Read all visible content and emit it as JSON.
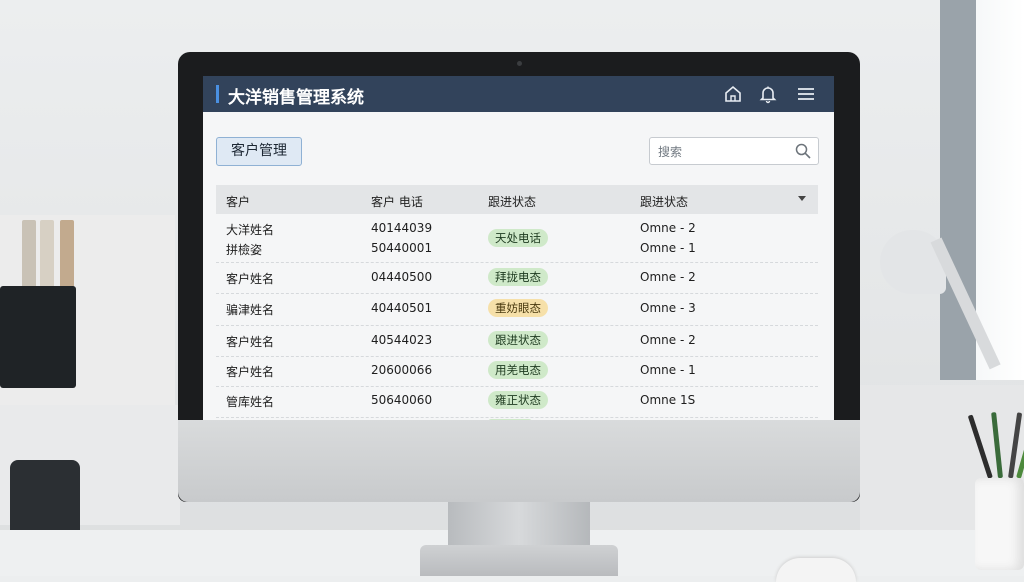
{
  "app": {
    "title": "大洋销售管理系统"
  },
  "toolbar": {
    "icons": [
      "home-icon",
      "bell-icon",
      "menu-icon"
    ]
  },
  "module": {
    "label": "客户管理"
  },
  "search": {
    "placeholder": "搜索"
  },
  "table": {
    "headers": [
      "客户",
      "客户 电话",
      "跟进状态",
      "跟进状态"
    ],
    "rows": [
      {
        "name": "大洋姓名",
        "name2": "拼檢姿",
        "phone": "40144039",
        "phone2": "50440001",
        "status": "天处电话",
        "status_color": "green",
        "owner": "Omne - 2",
        "owner2": "Omne - 1"
      },
      {
        "name": "客户姓名",
        "phone": "04440500",
        "status": "拜拢电态",
        "status_color": "green",
        "owner": "Omne - 2"
      },
      {
        "name": "骗津姓名",
        "phone": "40440501",
        "status": "重妨眼态",
        "status_color": "yellow",
        "owner": "Omne - 3"
      },
      {
        "name": "客户姓名",
        "phone": "40544023",
        "status": "跟进状态",
        "status_color": "green",
        "owner": "Omne - 2"
      },
      {
        "name": "客户姓名",
        "phone": "20600066",
        "status": "用羌电态",
        "status_color": "green",
        "owner": "Omne - 1"
      },
      {
        "name": "管库姓名",
        "phone": "50640060",
        "status": "雍正状态",
        "status_color": "green",
        "owner": "Omne 1S"
      }
    ]
  },
  "colors": {
    "titlebar": "#32435b",
    "accent": "#4a90e2",
    "badge_green": "#cfe9c9",
    "badge_yellow": "#f6e0a9"
  }
}
